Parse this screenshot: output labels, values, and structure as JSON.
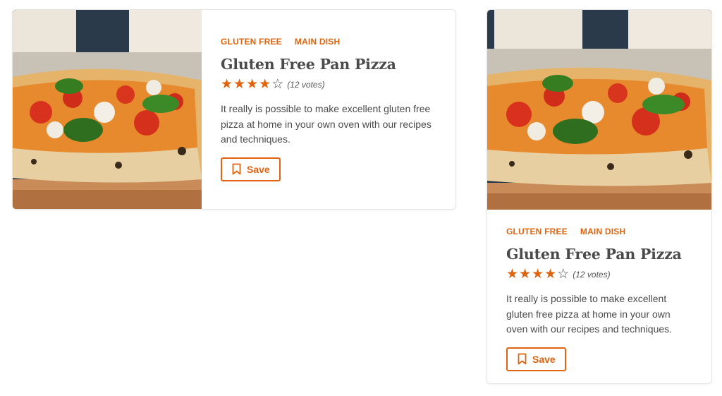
{
  "cards": [
    {
      "tags": [
        "GLUTEN FREE",
        "MAIN DISH"
      ],
      "title": "Gluten Free Pan Pizza",
      "rating": 4,
      "rating_max": 5,
      "votes": "(12 votes)",
      "description": "It really is possible to make excellent gluten free pizza at home in your own oven with our recipes and techniques.",
      "save_label": "Save",
      "image_icon": "pizza-photo"
    },
    {
      "tags": [
        "GLUTEN FREE",
        "MAIN DISH"
      ],
      "title": "Gluten Free Pan Pizza",
      "rating": 4,
      "rating_max": 5,
      "votes": "(12 votes)",
      "description": "It really is possible to make excellent gluten free pizza at home in your own oven with our recipes and techniques.",
      "save_label": "Save",
      "image_icon": "pizza-photo"
    }
  ],
  "colors": {
    "accent": "#e0640f",
    "text": "#4a4a4a",
    "border": "#e6e6e6"
  },
  "icons": {
    "save": "bookmark-icon",
    "star_filled": "star-filled-icon",
    "star_empty": "star-outline-icon"
  }
}
